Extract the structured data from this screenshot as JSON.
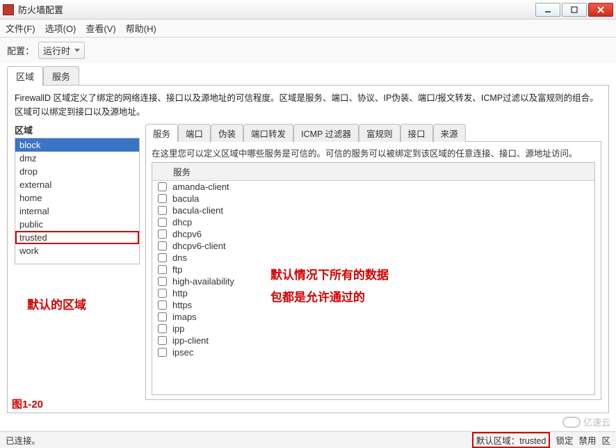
{
  "window": {
    "title": "防火墙配置"
  },
  "menubar": {
    "file": "文件(F)",
    "options": "选项(O)",
    "view": "查看(V)",
    "help": "帮助(H)"
  },
  "toolbar": {
    "config_label": "配置：",
    "config_value": "运行时"
  },
  "outer_tabs": {
    "zones": "区域",
    "services": "服务"
  },
  "zone_panel": {
    "description": "FirewallD 区域定义了绑定的网络连接、接口以及源地址的可信程度。区域是服务、端口、协议、IP伪装、端口/报文转发、ICMP过滤以及富规则的组合。区域可以绑定到接口以及源地址。",
    "header": "区域",
    "items": [
      {
        "id": "block",
        "label": "block",
        "selected": true
      },
      {
        "id": "dmz",
        "label": "dmz"
      },
      {
        "id": "drop",
        "label": "drop"
      },
      {
        "id": "external",
        "label": "external"
      },
      {
        "id": "home",
        "label": "home"
      },
      {
        "id": "internal",
        "label": "internal"
      },
      {
        "id": "public",
        "label": "public"
      },
      {
        "id": "trusted",
        "label": "trusted",
        "highlight": true
      },
      {
        "id": "work",
        "label": "work"
      }
    ],
    "annotation": "默认的区域",
    "figure_label": "图1-20"
  },
  "inner_tabs": {
    "services": "服务",
    "ports": "端口",
    "masquerade": "伪装",
    "port_forward": "端口转发",
    "icmp_filter": "ICMP 过滤器",
    "rich_rules": "富规则",
    "interfaces": "接口",
    "sources": "来源"
  },
  "services_panel": {
    "description": "在这里您可以定义区域中哪些服务是可信的。可信的服务可以被绑定到该区域的任意连接、接口、源地址访问。",
    "column_header": "服务",
    "items": [
      "amanda-client",
      "bacula",
      "bacula-client",
      "dhcp",
      "dhcpv6",
      "dhcpv6-client",
      "dns",
      "ftp",
      "high-availability",
      "http",
      "https",
      "imaps",
      "ipp",
      "ipp-client",
      "ipsec"
    ],
    "annotation_line1": "默认情况下所有的数据",
    "annotation_line2": "包都是允许通过的"
  },
  "status": {
    "connected": "已连接。",
    "default_zone_label": "默认区域：",
    "default_zone_value": "trusted",
    "locked": "锁定",
    "disable": "禁用",
    "extra": "区"
  },
  "watermark": "亿速云"
}
